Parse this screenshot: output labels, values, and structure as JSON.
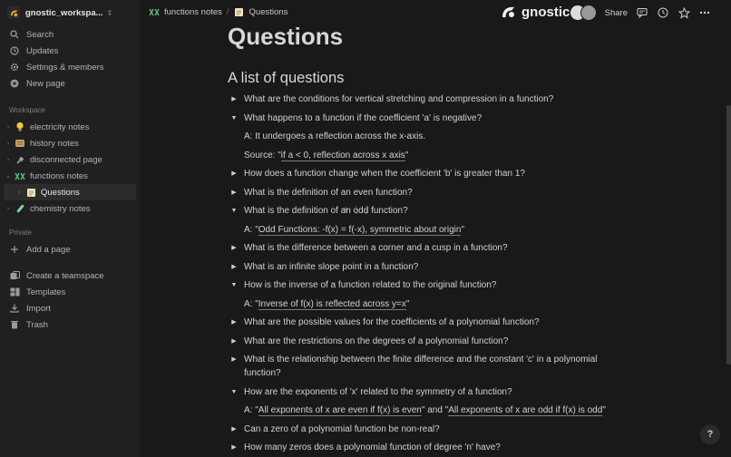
{
  "workspace": {
    "name": "gnostic_workspa..."
  },
  "sidebar": {
    "nav": [
      {
        "label": "Search",
        "icon": "search-icon"
      },
      {
        "label": "Updates",
        "icon": "clock-icon"
      },
      {
        "label": "Settings & members",
        "icon": "gear-icon"
      },
      {
        "label": "New page",
        "icon": "plus-circle-icon"
      }
    ],
    "workspace_label": "Workspace",
    "workspace_pages": [
      {
        "label": "electricity notes",
        "icon": "lightbulb-icon"
      },
      {
        "label": "history notes",
        "icon": "scroll-icon"
      },
      {
        "label": "disconnected page",
        "icon": "plug-icon"
      },
      {
        "label": "functions notes",
        "icon": "function-icon"
      },
      {
        "label": "Questions",
        "icon": "memo-icon"
      },
      {
        "label": "chemistry notes",
        "icon": "test-tube-icon"
      }
    ],
    "private_label": "Private",
    "add_page": "Add a page",
    "bottom": [
      {
        "label": "Create a teamspace",
        "icon": "teamspace-icon"
      },
      {
        "label": "Templates",
        "icon": "templates-icon"
      },
      {
        "label": "Import",
        "icon": "import-icon"
      },
      {
        "label": "Trash",
        "icon": "trash-icon"
      }
    ]
  },
  "breadcrumb": {
    "parent": "functions notes",
    "current": "Questions"
  },
  "brand": {
    "name": "gnostic"
  },
  "topbar": {
    "share": "Share"
  },
  "page": {
    "title": "Questions",
    "heading": "A list of questions",
    "items": [
      {
        "q": "What are the conditions for vertical stretching and compression in a function?",
        "open": false
      },
      {
        "q": "What happens to a function if the coefficient 'a' is negative?",
        "open": true,
        "answer_lines": [
          {
            "prefix": "A: It undergoes a reflection across the x-axis.",
            "link": "",
            "suffix": ""
          },
          {
            "prefix": "Source: \"",
            "link": "if a < 0, reflection across x axis",
            "suffix": "\""
          }
        ]
      },
      {
        "q": "How does a function change when the coefficient 'b' is greater than 1?",
        "open": false
      },
      {
        "q": "What is the definition of an even function?",
        "open": false
      },
      {
        "q": "What is the definition of an odd function?",
        "open": true,
        "answer_lines": [
          {
            "prefix": "A: \"",
            "link": "Odd Functions: -f(x) = f(-x), symmetric about origin",
            "suffix": "\""
          }
        ]
      },
      {
        "q": "What is the difference between a corner and a cusp in a function?",
        "open": false
      },
      {
        "q": "What is an infinite slope point in a function?",
        "open": false
      },
      {
        "q": "How is the inverse of a function related to the original function?",
        "open": true,
        "answer_lines": [
          {
            "prefix": "A: \"",
            "link": "Inverse of f(x) is reflected across y=x",
            "suffix": "\""
          }
        ]
      },
      {
        "q": "What are the possible values for the coefficients of a polynomial function?",
        "open": false
      },
      {
        "q": "What are the restrictions on the degrees of a polynomial function?",
        "open": false
      },
      {
        "q": "What is the relationship between the finite difference and the constant 'c' in a polynomial function?",
        "open": false
      },
      {
        "q": "How are the exponents of 'x' related to the symmetry of a function?",
        "open": true,
        "answer_lines": [
          {
            "prefix": "A: \"",
            "link": "All exponents of x are even if f(x) is even",
            "suffix": "\" and \"",
            "link2": "All exponents of x are odd if f(x) is odd",
            "suffix2": "\""
          }
        ]
      },
      {
        "q": "Can a zero of a polynomial function be non-real?",
        "open": false
      },
      {
        "q": "How many zeros does a polynomial function of degree 'n' have?",
        "open": false
      }
    ]
  },
  "help": "?"
}
